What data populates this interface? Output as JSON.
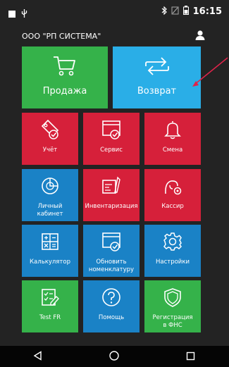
{
  "status": {
    "time": "16:15"
  },
  "header": {
    "company": "ООО \"РП СИСТЕМА\""
  },
  "main_actions": {
    "sale": "Продажа",
    "return": "Возврат"
  },
  "tiles": {
    "uchet": "Учёт",
    "service": "Сервис",
    "shift": "Смена",
    "cabinet_l1": "Личный",
    "cabinet_l2": "кабинет",
    "inventory": "Инвентаризация",
    "cashier": "Кассир",
    "calculator": "Калькулятор",
    "update_l1": "Обновить",
    "update_l2": "номенклатуру",
    "settings": "Настройки",
    "testfr": "Test FR",
    "help": "Помощь",
    "fns_l1": "Регистрация",
    "fns_l2": "в ФНС"
  },
  "colors": {
    "sale": "#35b24a",
    "return": "#2aaee7",
    "red": "#d6203a",
    "blue": "#1a82c6",
    "green": "#35b24a",
    "annotation": "#e0234a"
  }
}
